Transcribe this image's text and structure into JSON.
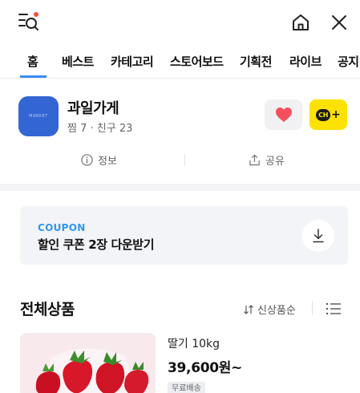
{
  "topbar": {
    "icons": [
      "menu-search-icon",
      "home-icon",
      "close-icon"
    ],
    "notification_dot_color": "#ff4d3a"
  },
  "tabs": [
    {
      "label": "홈",
      "active": true
    },
    {
      "label": "베스트",
      "active": false
    },
    {
      "label": "카테고리",
      "active": false
    },
    {
      "label": "스토어보드",
      "active": false
    },
    {
      "label": "기획전",
      "active": false
    },
    {
      "label": "라이브",
      "active": false
    },
    {
      "label": "공지",
      "active": false
    }
  ],
  "store": {
    "name": "과일가게",
    "meta": "찜 7 · 친구 23",
    "logo_text": "MARKET",
    "heart_color": "#f4505b",
    "chat_badge": "CH",
    "chat_plus": "+",
    "info_label": "정보",
    "share_label": "공유"
  },
  "coupon": {
    "label": "COUPON",
    "text": "할인 쿠폰 2장 다운받기"
  },
  "products": {
    "title": "전체상품",
    "sort_label": "신상품순",
    "items": [
      {
        "name": "딸기 10kg",
        "price": "39,600원~",
        "badge": "무료배송"
      }
    ]
  },
  "colors": {
    "accent": "#3a8ef6",
    "coupon_label": "#2e97f4",
    "kakao_yellow": "#fde100",
    "logo_blue": "#3465d4"
  }
}
